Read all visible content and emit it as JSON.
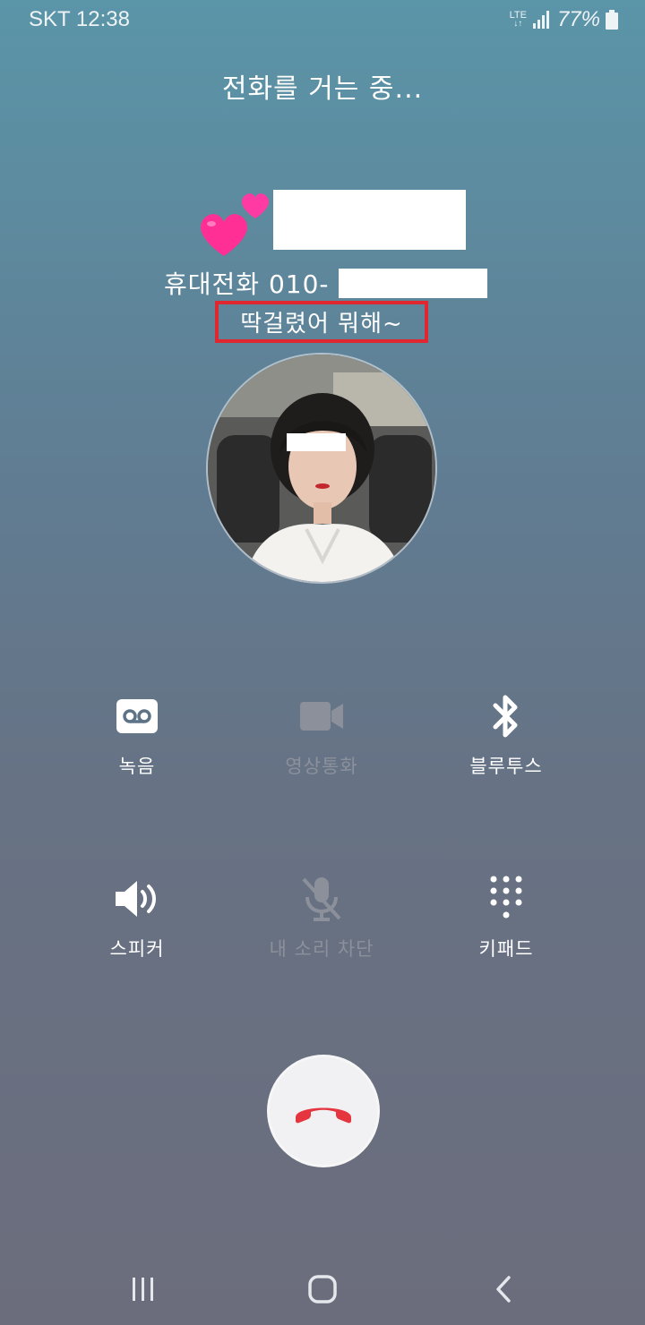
{
  "status_bar": {
    "carrier_time": "SKT 12:38",
    "network": "LTE",
    "battery": "77%"
  },
  "call": {
    "status_text": "전화를 거는 중...",
    "number_label": "휴대전화 010-",
    "memo": "딱걸렸어 뭐해~"
  },
  "actions": [
    {
      "label": "녹음",
      "icon": "voicemail-record-icon",
      "enabled": true
    },
    {
      "label": "영상통화",
      "icon": "video-camera-icon",
      "enabled": false
    },
    {
      "label": "블루투스",
      "icon": "bluetooth-icon",
      "enabled": true
    },
    {
      "label": "스피커",
      "icon": "speaker-icon",
      "enabled": true
    },
    {
      "label": "내 소리 차단",
      "icon": "mic-off-icon",
      "enabled": false
    },
    {
      "label": "키패드",
      "icon": "keypad-icon",
      "enabled": true
    }
  ],
  "colors": {
    "end_call": "#e5353f",
    "highlight_box": "#e0262e"
  }
}
